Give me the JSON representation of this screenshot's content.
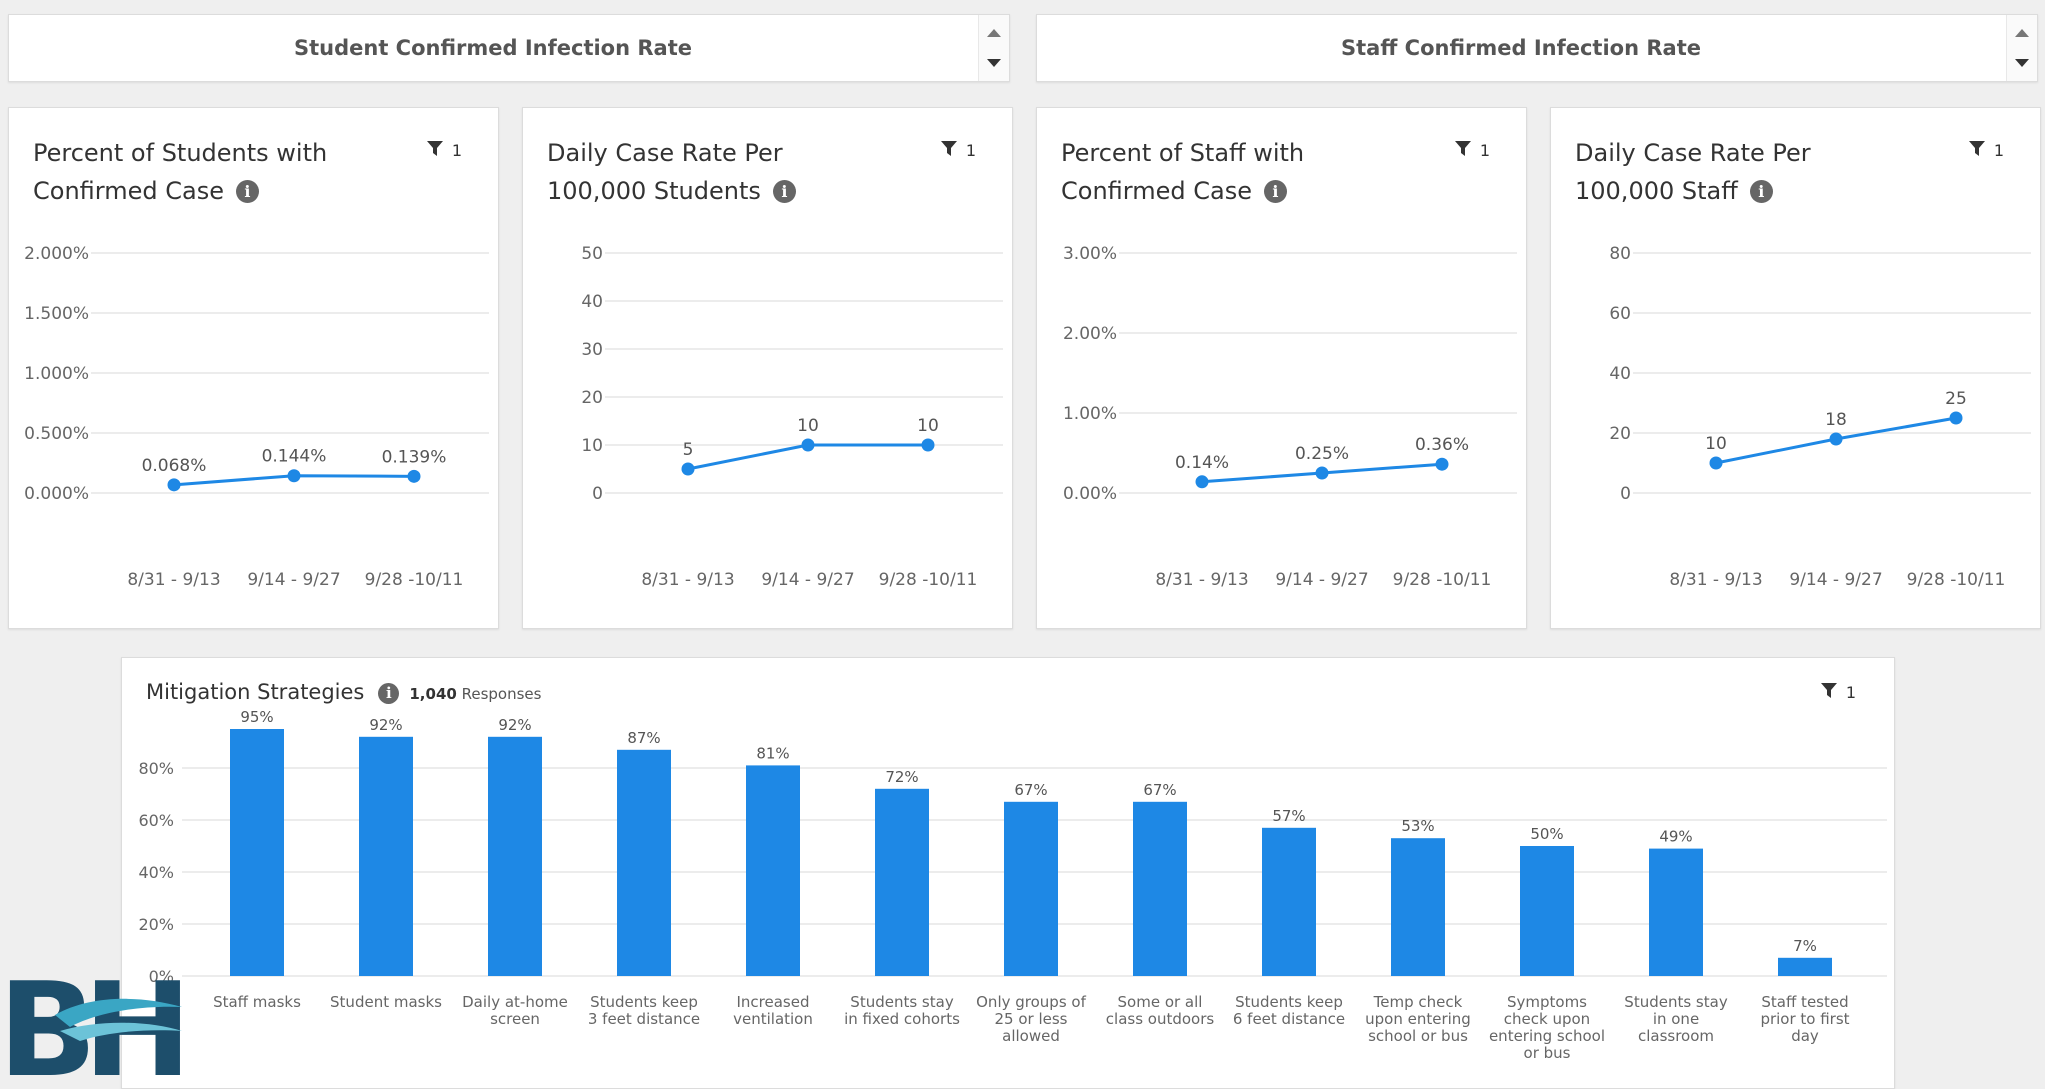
{
  "headers": [
    {
      "title": "Student Confirmed Infection Rate"
    },
    {
      "title": "Staff Confirmed Infection Rate"
    }
  ],
  "colors": {
    "accent": "#1e88e5",
    "grid": "#e6e6e6",
    "axis_text": "#666666"
  },
  "cards": [
    {
      "title": "Percent of Students with Confirmed Case",
      "has_info": true,
      "filter_count": "1"
    },
    {
      "title": "Daily Case Rate Per 100,000 Students",
      "has_info": true,
      "filter_count": "1"
    },
    {
      "title": "Percent of Staff with Confirmed Case",
      "has_info": true,
      "filter_count": "1"
    },
    {
      "title": "Daily Case Rate Per 100,000 Staff",
      "has_info": true,
      "filter_count": "1"
    }
  ],
  "bar_panel": {
    "title": "Mitigation Strategies",
    "responses_count": "1,040",
    "responses_label": "Responses",
    "filter_count": "1"
  },
  "chart_data": [
    {
      "type": "line",
      "categories": [
        "8/31 - 9/13",
        "9/14 - 9/27",
        "9/28 -10/11"
      ],
      "values": [
        0.068,
        0.144,
        0.139
      ],
      "data_labels": [
        "0.068%",
        "0.144%",
        "0.139%"
      ],
      "yticks": [
        0,
        0.5,
        1.0,
        1.5,
        2.0
      ],
      "ytick_labels": [
        "0.000%",
        "0.500%",
        "1.000%",
        "1.500%",
        "2.000%"
      ],
      "ylim": [
        0,
        2.0
      ],
      "grid": true
    },
    {
      "type": "line",
      "categories": [
        "8/31 - 9/13",
        "9/14 - 9/27",
        "9/28 -10/11"
      ],
      "values": [
        5,
        10,
        10
      ],
      "data_labels": [
        "5",
        "10",
        "10"
      ],
      "yticks": [
        0,
        10,
        20,
        30,
        40,
        50
      ],
      "ytick_labels": [
        "0",
        "10",
        "20",
        "30",
        "40",
        "50"
      ],
      "ylim": [
        0,
        50
      ],
      "grid": true
    },
    {
      "type": "line",
      "categories": [
        "8/31 - 9/13",
        "9/14 - 9/27",
        "9/28 -10/11"
      ],
      "values": [
        0.14,
        0.25,
        0.36
      ],
      "data_labels": [
        "0.14%",
        "0.25%",
        "0.36%"
      ],
      "yticks": [
        0,
        1,
        2,
        3
      ],
      "ytick_labels": [
        "0.00%",
        "1.00%",
        "2.00%",
        "3.00%"
      ],
      "ylim": [
        0,
        3
      ],
      "grid": true
    },
    {
      "type": "line",
      "categories": [
        "8/31 - 9/13",
        "9/14 - 9/27",
        "9/28 -10/11"
      ],
      "values": [
        10,
        18,
        25
      ],
      "data_labels": [
        "10",
        "18",
        "25"
      ],
      "yticks": [
        0,
        20,
        40,
        60,
        80
      ],
      "ytick_labels": [
        "0",
        "20",
        "40",
        "60",
        "80"
      ],
      "ylim": [
        0,
        80
      ],
      "grid": true
    },
    {
      "type": "bar",
      "categories": [
        "Staff masks",
        "Student masks",
        "Daily at-home screen",
        "Students keep 3 feet distance",
        "Increased ventilation",
        "Students stay in fixed cohorts",
        "Only groups of 25 or less allowed",
        "Some or all class outdoors",
        "Students keep 6 feet distance",
        "Temp check upon entering school or bus",
        "Symptoms check upon entering school or bus",
        "Students stay in one classroom",
        "Staff tested prior to first day"
      ],
      "category_lines": [
        [
          "Staff masks"
        ],
        [
          "Student masks"
        ],
        [
          "Daily at-home",
          "screen"
        ],
        [
          "Students keep",
          "3 feet distance"
        ],
        [
          "Increased",
          "ventilation"
        ],
        [
          "Students stay",
          "in fixed cohorts"
        ],
        [
          "Only groups of",
          "25 or less",
          "allowed"
        ],
        [
          "Some or all",
          "class outdoors"
        ],
        [
          "Students keep",
          "6 feet distance"
        ],
        [
          "Temp check",
          "upon entering",
          "school or bus"
        ],
        [
          "Symptoms",
          "check upon",
          "entering school",
          "or bus"
        ],
        [
          "Students stay",
          "in one",
          "classroom"
        ],
        [
          "Staff tested",
          "prior to first",
          "day"
        ]
      ],
      "values": [
        95,
        92,
        92,
        87,
        81,
        72,
        67,
        67,
        57,
        53,
        50,
        49,
        7
      ],
      "data_labels": [
        "95%",
        "92%",
        "92%",
        "87%",
        "81%",
        "72%",
        "67%",
        "67%",
        "57%",
        "53%",
        "50%",
        "49%",
        "7%"
      ],
      "yticks": [
        0,
        20,
        40,
        60,
        80
      ],
      "ytick_labels": [
        "0%",
        "20%",
        "40%",
        "60%",
        "80%"
      ],
      "ylim": [
        0,
        100
      ],
      "grid": true
    }
  ],
  "logo": {
    "text": "BH"
  }
}
